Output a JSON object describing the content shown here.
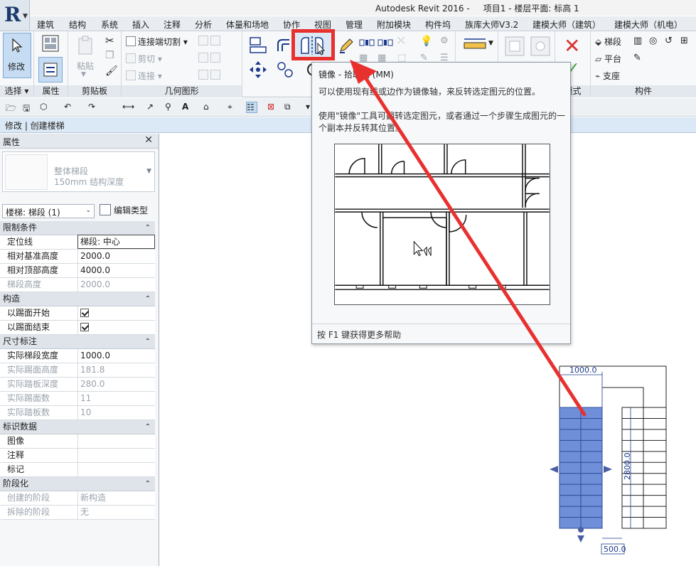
{
  "window": {
    "title": "Autodesk Revit 2016 -     项目1 - 楼层平面: 标高 1"
  },
  "tabs": [
    {
      "label": "建筑"
    },
    {
      "label": "结构"
    },
    {
      "label": "系统"
    },
    {
      "label": "插入"
    },
    {
      "label": "注释"
    },
    {
      "label": "分析"
    },
    {
      "label": "体量和场地"
    },
    {
      "label": "协作"
    },
    {
      "label": "视图"
    },
    {
      "label": "管理"
    },
    {
      "label": "附加模块"
    },
    {
      "label": "构件坞"
    },
    {
      "label": "族库大师V3.2"
    },
    {
      "label": "建模大师（建筑）"
    },
    {
      "label": "建模大师（机电）"
    }
  ],
  "ribbon": {
    "modify_label": "修改",
    "select_label": "选择 ▾",
    "properties_label": "属性",
    "clipboard": {
      "paste_label": "粘贴",
      "panel_title": "剪贴板"
    },
    "geometry": {
      "join_cut_label": "连接端切割 ▾",
      "cut_label": "剪切 ▾",
      "join_label": "连接 ▾",
      "panel_title": "几何图形"
    },
    "mode_title": "模式",
    "component": {
      "run_label": "梯段",
      "landing_label": "平台",
      "support_label": "支座",
      "panel_title": "构件"
    }
  },
  "context_bar": {
    "text": "修改 | 创建楼梯"
  },
  "properties": {
    "title": "属性",
    "close": "✕",
    "type_name_line1": "整体梯段",
    "type_name_line2": "150mm 结构深度",
    "instance_selector": "楼梯: 梯段 (1)",
    "edit_type_label": "编辑类型",
    "groups": [
      {
        "name": "限制条件",
        "toggle": "⌃",
        "rows": [
          {
            "key": "定位线",
            "value": "梯段: 中心",
            "editing": true
          },
          {
            "key": "相对基准高度",
            "value": "2000.0"
          },
          {
            "key": "相对顶部高度",
            "value": "4000.0"
          },
          {
            "key": "梯段高度",
            "value": "2000.0",
            "dim": true
          }
        ]
      },
      {
        "name": "构造",
        "toggle": "⌃",
        "rows": [
          {
            "key": "以踢面开始",
            "check": true
          },
          {
            "key": "以踢面结束",
            "check": true
          }
        ]
      },
      {
        "name": "尺寸标注",
        "toggle": "⌃",
        "rows": [
          {
            "key": "实际梯段宽度",
            "value": "1000.0"
          },
          {
            "key": "实际踢面高度",
            "value": "181.8",
            "dim": true
          },
          {
            "key": "实际踏板深度",
            "value": "280.0",
            "dim": true
          },
          {
            "key": "实际踢面数",
            "value": "11",
            "dim": true
          },
          {
            "key": "实际踏板数",
            "value": "10",
            "dim": true
          }
        ]
      },
      {
        "name": "标识数据",
        "toggle": "⌃",
        "rows": [
          {
            "key": "图像",
            "value": ""
          },
          {
            "key": "注释",
            "value": ""
          },
          {
            "key": "标记",
            "value": ""
          }
        ]
      },
      {
        "name": "阶段化",
        "toggle": "⌃",
        "rows": [
          {
            "key": "创建的阶段",
            "value": "新构造",
            "dim": true
          },
          {
            "key": "拆除的阶段",
            "value": "无",
            "dim": true
          }
        ]
      }
    ]
  },
  "tooltip": {
    "title": "镜像 - 拾取轴 (MM)",
    "desc1": "可以使用现有线或边作为镜像轴，来反转选定图元的位置。",
    "desc2": "使用\"镜像\"工具可翻转选定图元，或者通过一个步骤生成图元的一个副本并反转其位置。",
    "help": "按 F1 键获得更多帮助"
  },
  "stair": {
    "width_dim": "1000.0",
    "length_dim": "2800.0",
    "offset_dim": "500.0"
  },
  "colors": {
    "highlight": "#e8312f",
    "selected_run": "#6f8fd8",
    "ribbon_active": "#c6dcf2"
  }
}
